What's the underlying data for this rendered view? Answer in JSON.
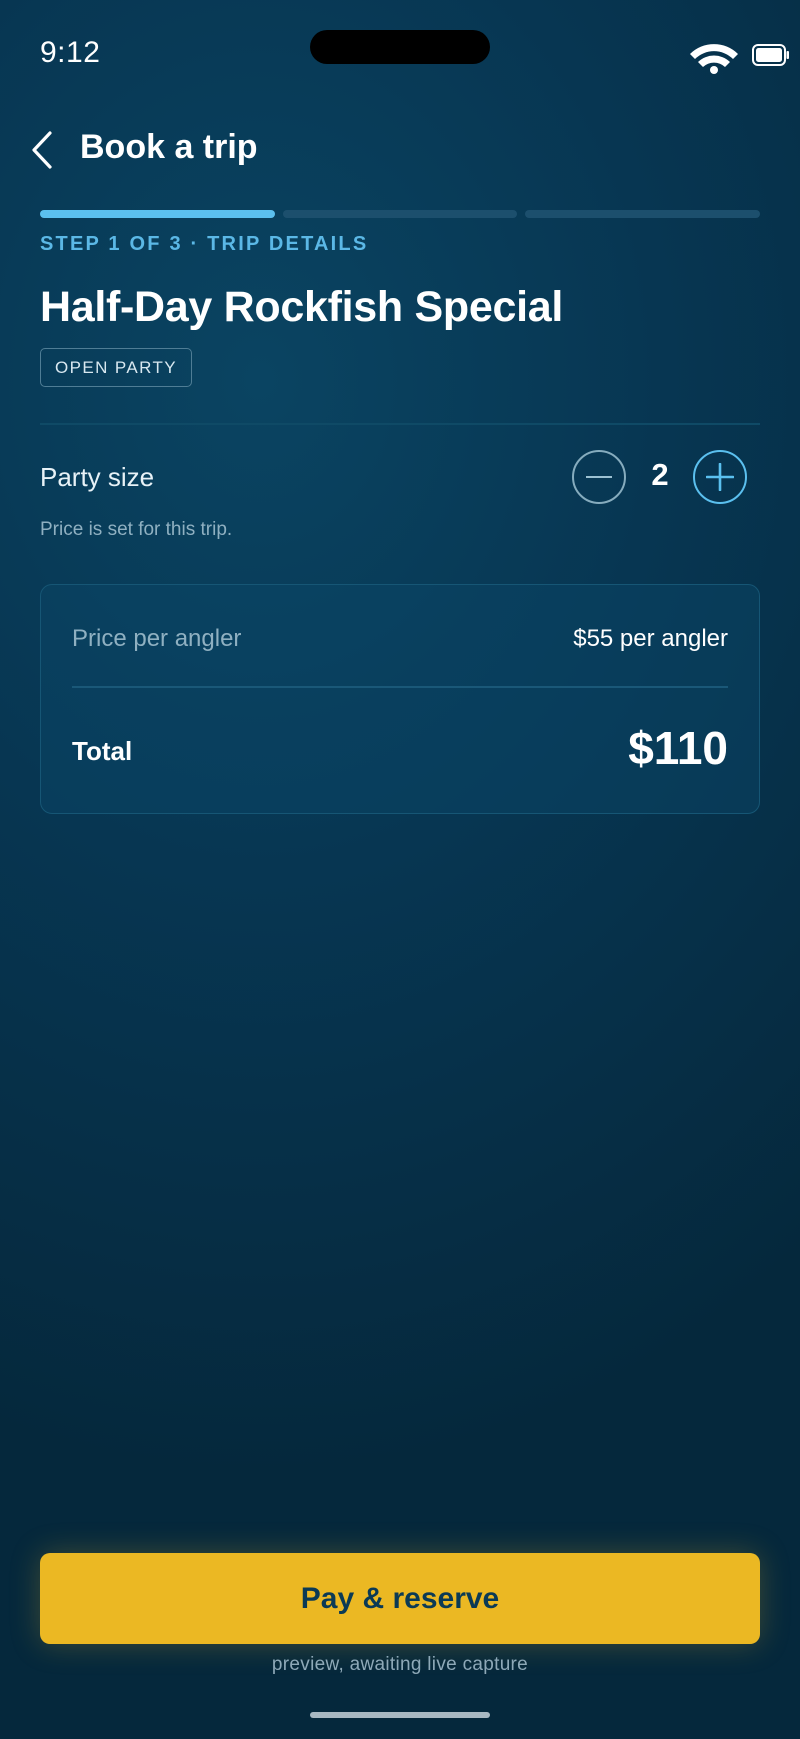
{
  "status_bar": {
    "time": "9:12",
    "icons": [
      "wifi-icon",
      "battery-icon"
    ]
  },
  "nav": {
    "back_icon": "chevron-left-icon",
    "title": "Book a trip"
  },
  "progress": {
    "total_steps": 3,
    "current_step": 1
  },
  "step": {
    "label": "STEP 1 OF 3 · TRIP DETAILS"
  },
  "trip": {
    "title": "Half-Day Rockfish Special",
    "badge": "OPEN PARTY"
  },
  "party": {
    "label": "Party size",
    "value": "2",
    "minus_icon": "minus-icon",
    "plus_icon": "plus-icon",
    "note": "Price is set for this trip."
  },
  "pricing": {
    "per_angler_label": "Price per angler",
    "per_angler_value": "$55 per angler",
    "total_label": "Total",
    "total_value": "$110"
  },
  "cta": {
    "label": "Pay & reserve",
    "note": "preview, awaiting live capture"
  },
  "colors": {
    "background": "#073652",
    "accent": "#5bc0ef",
    "cta": "#ebb823",
    "cta_text": "#0b3a55"
  }
}
